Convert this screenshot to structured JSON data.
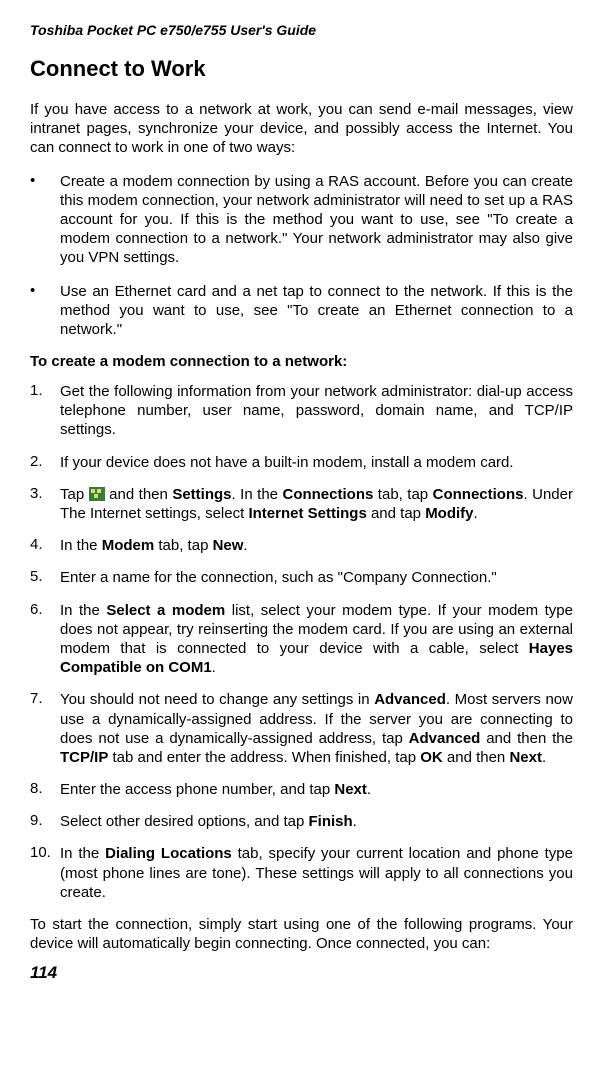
{
  "runningHead": "Toshiba Pocket PC e750/e755  User's Guide",
  "title": "Connect  to Work",
  "intro": "If you have access to a network at work, you can send e-mail messages, view intranet pages, synchronize your device, and possibly access the Internet. You can connect to work in one of two ways:",
  "bullets": [
    "Create a modem connection by using a RAS account. Before you can create this modem connection, your network administrator will need to set up a RAS account for you. If this is the method you want to use, see \"To create a modem connection to a network.\" Your network administrator may also give you VPN settings.",
    "Use an Ethernet card and a net tap to connect to the network. If this is the method you want to use, see \"To create an Ethernet connection to a network.\""
  ],
  "subhead": "To create a modem connection to a network:",
  "steps": [
    {
      "num": "1.",
      "text": "Get the following information from your network administrator: dial-up access telephone number, user name, password, domain name, and TCP/IP settings."
    },
    {
      "num": "2.",
      "text": "If your device does not have a built-in modem, install a modem card."
    },
    {
      "num": "3.",
      "pre": "Tap ",
      "post1": " and then ",
      "b1": "Settings",
      "mid1": ". In the ",
      "b2": "Connections",
      "mid2": " tab, tap ",
      "b3": "Connections",
      "mid3": ". Under The Internet settings, select ",
      "b4": "Internet Settings",
      "mid4": " and tap ",
      "b5": "Modify",
      "end": "."
    },
    {
      "num": "4.",
      "pre": "In the  ",
      "b1": "Modem",
      "mid1": " tab, tap ",
      "b2": "New",
      "end": "."
    },
    {
      "num": "5.",
      "text": "Enter a name for the connection, such as \"Company Connection.\""
    },
    {
      "num": "6.",
      "pre": "In the  ",
      "b1": "Select a modem",
      "mid1": " list, select your modem type. If your modem type does not appear, try reinserting the modem card. If you are using an external modem that is connected to your device with a cable, select ",
      "b2": "Hayes Compatible on COM1",
      "end": "."
    },
    {
      "num": "7.",
      "pre": "You should not need to change any settings in  ",
      "b1": "Advanced",
      "mid1": ". Most servers now use a dynamically-assigned address. If the server you are connecting to does not use a dynamically-assigned address, tap ",
      "b2": "Advanced",
      "mid2": " and then the ",
      "b3": "TCP/IP",
      "mid3": " tab and enter the address. When finished, tap ",
      "b4": "OK",
      "mid4": " and then  ",
      "b5": "Next",
      "end": "."
    },
    {
      "num": "8.",
      "pre": "Enter the access phone number, and tap ",
      "b1": "Next",
      "end": "."
    },
    {
      "num": "9.",
      "pre": "Select other desired options, and tap ",
      "b1": "Finish",
      "end": "."
    },
    {
      "num": "10.",
      "pre": "In the ",
      "b1": "Dialing Locations",
      "mid1": " tab, specify your current location and phone type (most phone lines are tone). These settings will apply to all connections you create.",
      "end": ""
    }
  ],
  "closing": "To start the connection, simply start using one of the following programs. Your device will automatically begin connecting. Once connected, you can:",
  "pageNum": "114"
}
